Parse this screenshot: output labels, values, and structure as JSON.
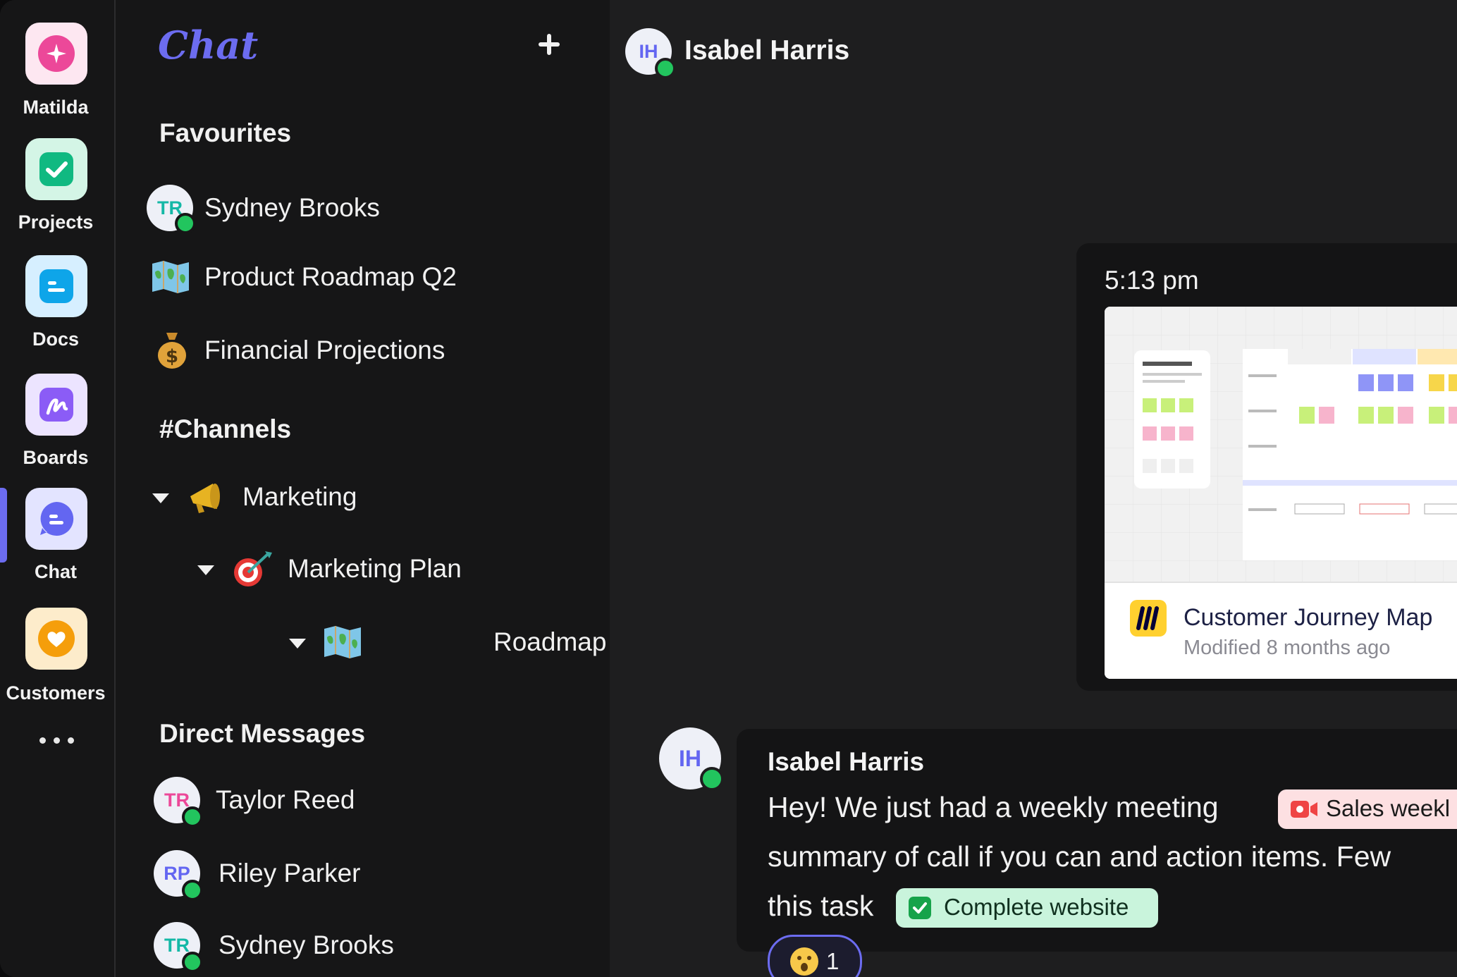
{
  "rail": {
    "items": [
      {
        "label": "Matilda",
        "icon": "sparkle-icon",
        "color": "#ec4899"
      },
      {
        "label": "Projects",
        "icon": "check-icon",
        "color": "#10b981"
      },
      {
        "label": "Docs",
        "icon": "doc-icon",
        "color": "#0ea5e9"
      },
      {
        "label": "Boards",
        "icon": "pen-icon",
        "color": "#8b5cf6"
      },
      {
        "label": "Chat",
        "icon": "chat-bubble-icon",
        "color": "#6366f1"
      },
      {
        "label": "Customers",
        "icon": "heart-icon",
        "color": "#f59e0b"
      }
    ],
    "active": "Chat",
    "more_icon": "more-icon"
  },
  "sidebar": {
    "title": "Chat",
    "favourites_heading": "Favourites",
    "favourites": [
      {
        "label": "Sydney Brooks",
        "initials": "TR"
      },
      {
        "label": "Product Roadmap Q2",
        "icon": "map-icon"
      },
      {
        "label": "Financial Projections",
        "icon": "money-bag-icon"
      }
    ],
    "channels_heading": "#Channels",
    "channels": [
      {
        "label": "Marketing",
        "icon": "megaphone-icon"
      },
      {
        "label": "Marketing Plan",
        "icon": "target-icon"
      },
      {
        "label": "Roadmap",
        "icon": "map-icon"
      }
    ],
    "dm_heading": "Direct Messages",
    "dms": [
      {
        "label": "Taylor Reed",
        "initials": "TR"
      },
      {
        "label": "Riley Parker",
        "initials": "RP"
      },
      {
        "label": "Sydney Brooks",
        "initials": "TR"
      }
    ]
  },
  "header": {
    "name": "Isabel Harris",
    "initials": "IH"
  },
  "messages": {
    "time": "5:13 pm",
    "file": {
      "title": "Customer Journey Map",
      "subtitle": "Modified 8 months ago"
    },
    "msg": {
      "initials": "IH",
      "author": "Isabel Harris",
      "line1": "Hey! We just had a weekly meeting",
      "chip1": "Sales weekl",
      "line2": "summary of call if you can and action items. Few",
      "line3": "this task",
      "chip2": "Complete website",
      "reaction_count": "1"
    }
  },
  "colors": {
    "accent": "#6c6cf0",
    "presence": "#22c55e",
    "background": "#1e1e1f"
  }
}
